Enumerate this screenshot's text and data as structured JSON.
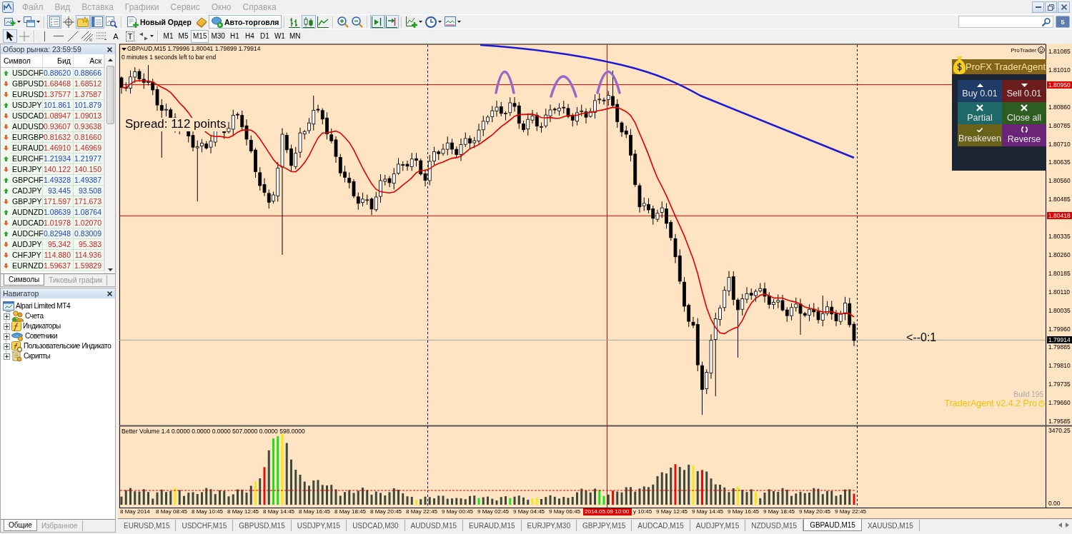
{
  "menu": {
    "items": [
      "Файл",
      "Вид",
      "Вставка",
      "Графики",
      "Сервис",
      "Окно",
      "Справка"
    ]
  },
  "toolbar": {
    "groups": [
      [
        {
          "kind": "new_chart",
          "pressed": false
        },
        {
          "kind": "profiles",
          "pressed": false
        }
      ],
      [
        {
          "kind": "market_watch",
          "pressed": true
        },
        {
          "kind": "data_window",
          "pressed": false
        },
        {
          "kind": "navigator",
          "pressed": true
        },
        {
          "kind": "terminal",
          "pressed": true
        },
        {
          "kind": "tester",
          "pressed": false
        }
      ],
      [
        {
          "kind": "new_order",
          "label": "Новый Ордер",
          "pressed": false
        },
        {
          "kind": "editor",
          "pressed": false
        },
        {
          "kind": "auto_trading",
          "label": "Авто-торговля",
          "pressed": true
        }
      ],
      [
        {
          "kind": "bars",
          "pressed": false
        },
        {
          "kind": "candles",
          "pressed": true
        },
        {
          "kind": "line",
          "pressed": false
        }
      ],
      [
        {
          "kind": "zoom_in",
          "pressed": false
        },
        {
          "kind": "zoom_out",
          "pressed": false
        }
      ],
      [
        {
          "kind": "auto_scroll",
          "pressed": true
        },
        {
          "kind": "chart_shift",
          "pressed": true
        }
      ],
      [
        {
          "kind": "indicators",
          "pressed": false
        },
        {
          "kind": "periods",
          "pressed": false
        },
        {
          "kind": "templates",
          "pressed": false
        }
      ]
    ]
  },
  "messages": {
    "count": "5"
  },
  "drawing_tools": {
    "groups": [
      [
        {
          "kind": "cursor",
          "selected": true
        },
        {
          "kind": "crosshair",
          "selected": false
        }
      ],
      [
        {
          "kind": "vertical_line",
          "selected": false
        },
        {
          "kind": "horizontal_line",
          "selected": false
        },
        {
          "kind": "trend_line",
          "selected": false
        },
        {
          "kind": "channel",
          "selected": false
        },
        {
          "kind": "fibonacci",
          "selected": false
        },
        {
          "kind": "text",
          "glyph": "A",
          "selected": false
        },
        {
          "kind": "label",
          "glyph": "T",
          "selected": false
        },
        {
          "kind": "arrows",
          "selected": false
        }
      ]
    ]
  },
  "timeframes": [
    {
      "label": "M1",
      "selected": false
    },
    {
      "label": "M5",
      "selected": false
    },
    {
      "label": "M15",
      "selected": true
    },
    {
      "label": "M30",
      "selected": false
    },
    {
      "label": "H1",
      "selected": false
    },
    {
      "label": "H4",
      "selected": false
    },
    {
      "label": "D1",
      "selected": false
    },
    {
      "label": "W1",
      "selected": false
    },
    {
      "label": "MN",
      "selected": false
    }
  ],
  "market_watch": {
    "title": "Обзор рынка: 23:59:59",
    "columns": [
      "Символ",
      "Бид",
      "Аск"
    ],
    "rows": [
      {
        "symbol": "USDCHF",
        "rising": true,
        "bid": "0.88620",
        "ask": "0.88666"
      },
      {
        "symbol": "GBPUSD",
        "rising": false,
        "bid": "1.68468",
        "ask": "1.68512"
      },
      {
        "symbol": "EURUSD",
        "rising": false,
        "bid": "1.37577",
        "ask": "1.37587"
      },
      {
        "symbol": "USDJPY",
        "rising": true,
        "bid": "101.861",
        "ask": "101.879"
      },
      {
        "symbol": "USDCAD",
        "rising": false,
        "bid": "1.08947",
        "ask": "1.09013"
      },
      {
        "symbol": "AUDUSD",
        "rising": false,
        "bid": "0.93607",
        "ask": "0.93638"
      },
      {
        "symbol": "EURGBP",
        "rising": false,
        "bid": "0.81632",
        "ask": "0.81660"
      },
      {
        "symbol": "EURAUD",
        "rising": false,
        "bid": "1.46910",
        "ask": "1.46969"
      },
      {
        "symbol": "EURCHF",
        "rising": true,
        "bid": "1.21934",
        "ask": "1.21977"
      },
      {
        "symbol": "EURJPY",
        "rising": false,
        "bid": "140.122",
        "ask": "140.150"
      },
      {
        "symbol": "GBPCHF",
        "rising": true,
        "bid": "1.49328",
        "ask": "1.49387"
      },
      {
        "symbol": "CADJPY",
        "rising": true,
        "bid": "93.445",
        "ask": "93.508"
      },
      {
        "symbol": "GBPJPY",
        "rising": false,
        "bid": "171.597",
        "ask": "171.673"
      },
      {
        "symbol": "AUDNZD",
        "rising": true,
        "bid": "1.08639",
        "ask": "1.08764"
      },
      {
        "symbol": "AUDCAD",
        "rising": false,
        "bid": "1.01978",
        "ask": "1.02070"
      },
      {
        "symbol": "AUDCHF",
        "rising": true,
        "bid": "0.82948",
        "ask": "0.83009"
      },
      {
        "symbol": "AUDJPY",
        "rising": false,
        "bid": "95.342",
        "ask": "95.383"
      },
      {
        "symbol": "CHFJPY",
        "rising": false,
        "bid": "114.880",
        "ask": "114.936"
      },
      {
        "symbol": "EURNZD",
        "rising": false,
        "bid": "1.59637",
        "ask": "1.59829"
      }
    ],
    "tabs": [
      {
        "label": "Символы",
        "selected": true
      },
      {
        "label": "Тиковый график",
        "selected": false
      }
    ]
  },
  "navigator": {
    "title": "Навигатор",
    "root": {
      "label": "Alpari Limited MT4",
      "children": [
        {
          "label": "Счета",
          "kind": "accounts",
          "expanded": false
        },
        {
          "label": "Индикаторы",
          "kind": "indicators",
          "expanded": false
        },
        {
          "label": "Советники",
          "kind": "experts",
          "expanded": false
        },
        {
          "label": "Пользовательские Индикато",
          "kind": "custom_indicators",
          "expanded": false
        },
        {
          "label": "Скрипты",
          "kind": "scripts",
          "expanded": false
        }
      ]
    },
    "tabs": [
      {
        "label": "Общие",
        "selected": true
      },
      {
        "label": "Избранное",
        "selected": false
      }
    ]
  },
  "chart": {
    "title": "GBPAUD,M15 1.79996 1.80041 1.79899 1.79914",
    "timer": "0 minutes 1 seconds left to bar end",
    "spread": "Spread: 112 points",
    "signal": "<--0:1",
    "brand": "ProTrader",
    "build": "Build 195",
    "version": "TraderAgent v2.4.2 Pro",
    "trade_panel": {
      "title": "ProFX TraderAgent",
      "buttons": [
        {
          "kind": "buy",
          "label": "Buy 0.01"
        },
        {
          "kind": "sell",
          "label": "Sell 0.01"
        },
        {
          "kind": "partial",
          "label": "Partial"
        },
        {
          "kind": "close_all",
          "label": "Close all"
        },
        {
          "kind": "breakeven",
          "label": "Breakeven"
        },
        {
          "kind": "reverse",
          "label": "Reverse"
        }
      ]
    },
    "price_axis": [
      "1.81085",
      "1.81010",
      "1.80860",
      "1.80785",
      "1.80710",
      "1.80635",
      "1.80560",
      "1.80485",
      "1.80335",
      "1.80260",
      "1.80185",
      "1.80110",
      "1.80035",
      "1.79960",
      "1.79885",
      "1.79810",
      "1.79735",
      "1.79660",
      "1.79585"
    ],
    "price_tags": [
      {
        "kind": "level",
        "label": "1.80950"
      },
      {
        "kind": "level",
        "label": "1.80418"
      },
      {
        "kind": "bid",
        "label": "1.79914"
      }
    ],
    "volume": {
      "title": "Better Volume 1.4 0.0000 0.0000 0.0000 507.0000 0.0000 598.0000",
      "axis": [
        "3470.25",
        "0.00"
      ]
    },
    "time_axis": [
      {
        "kind": "tick",
        "label": "8 May 2014"
      },
      {
        "kind": "tick",
        "label": "8 May 08:45"
      },
      {
        "kind": "tick",
        "label": "8 May 10:45"
      },
      {
        "kind": "tick",
        "label": "8 May 12:45"
      },
      {
        "kind": "tick",
        "label": "8 May 14:45"
      },
      {
        "kind": "tick",
        "label": "8 May 16:45"
      },
      {
        "kind": "tick",
        "label": "8 May 18:45"
      },
      {
        "kind": "tick",
        "label": "8 May 20:45"
      },
      {
        "kind": "tick",
        "label": "8 May 22:45"
      },
      {
        "kind": "tick",
        "label": "9 May 00:45"
      },
      {
        "kind": "tick",
        "label": "9 May 02:45"
      },
      {
        "kind": "tick",
        "label": "9 May 04:45"
      },
      {
        "kind": "tick",
        "label": "9 May 06:45"
      },
      {
        "kind": "cursor",
        "label": "2014.05.09 10:00"
      },
      {
        "kind": "tick",
        "label": "y 10:45"
      },
      {
        "kind": "tick",
        "label": "9 May 12:45"
      },
      {
        "kind": "tick",
        "label": "9 May 14:45"
      },
      {
        "kind": "tick",
        "label": "9 May 16:45"
      },
      {
        "kind": "tick",
        "label": "9 May 18:45"
      },
      {
        "kind": "tick",
        "label": "9 May 20:45"
      },
      {
        "kind": "tick",
        "label": "9 May 22:45"
      }
    ]
  },
  "chart_tabs": [
    {
      "label": "EURUSD,M15",
      "selected": false
    },
    {
      "label": "USDCHF,M15",
      "selected": false
    },
    {
      "label": "GBPUSD,M15",
      "selected": false
    },
    {
      "label": "USDJPY,M15",
      "selected": false
    },
    {
      "label": "USDCAD,M30",
      "selected": false
    },
    {
      "label": "AUDUSD,M15",
      "selected": false
    },
    {
      "label": "EURAUD,M15",
      "selected": false
    },
    {
      "label": "EURJPY,M30",
      "selected": false
    },
    {
      "label": "GBPJPY,M15",
      "selected": false
    },
    {
      "label": "AUDCAD,M15",
      "selected": false
    },
    {
      "label": "AUDJPY,M15",
      "selected": false
    },
    {
      "label": "NZDUSD,M15",
      "selected": false
    },
    {
      "label": "GBPAUD,M15",
      "selected": true
    },
    {
      "label": "XAUUSD,M15",
      "selected": false
    }
  ]
}
